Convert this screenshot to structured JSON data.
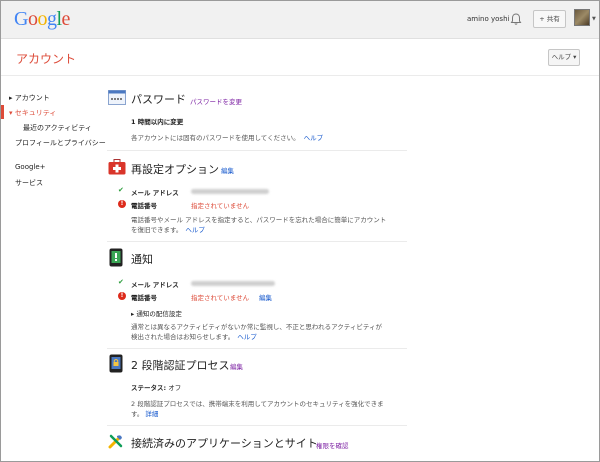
{
  "topbar": {
    "logo": [
      "G",
      "o",
      "o",
      "g",
      "l",
      "e"
    ],
    "logo_colors": [
      "#4285f4",
      "#dd4b39",
      "#f4b400",
      "#4285f4",
      "#0f9d58",
      "#dd4b39"
    ],
    "user_name": "amino yoshi",
    "share_label": "+ 共有"
  },
  "header": {
    "title": "アカウント",
    "help_label": "ヘルプ ▾"
  },
  "sidebar": {
    "items": [
      {
        "label": "▸ アカウント"
      },
      {
        "label": "▾ セキュリティ"
      },
      {
        "label": "最近のアクティビティ"
      },
      {
        "label": "プロフィールとプライバシー"
      },
      {
        "label": "Google+"
      },
      {
        "label": "サービス"
      }
    ]
  },
  "password": {
    "title": "パスワード",
    "link": "パスワードを変更",
    "changed": "1 時間以内に変更",
    "desc": "各アカウントには固有のパスワードを使用してください。",
    "help": "ヘルプ"
  },
  "recovery": {
    "title": "再設定オプション",
    "edit": "編集",
    "email_label": "メール アドレス",
    "phone_label": "電話番号",
    "phone_value": "指定されていません",
    "desc1": "電話番号やメール アドレスを指定すると、パスワードを忘れた場合に簡単にアカウント",
    "desc2": "を復旧できます。",
    "help": "ヘルプ"
  },
  "notify": {
    "title": "通知",
    "email_label": "メール アドレス",
    "phone_label": "電話番号",
    "phone_value": "指定されていません",
    "edit": "編集",
    "delivery": "▸ 通知の配信設定",
    "desc1": "通常とは異なるアクティビティがないか常に監視し、不正と思われるアクティビティが",
    "desc2": "検出された場合はお知らせします。",
    "help": "ヘルプ"
  },
  "twostep": {
    "title": "2 段階認証プロセス",
    "edit": "編集",
    "status_label": "ステータス:",
    "status_value": "オフ",
    "desc1": "2 段階認証プロセスでは、携帯端末を利用してアカウントのセキュリティを強化できま",
    "desc2": "す。",
    "details": "詳細"
  },
  "apps": {
    "title": "接続済みのアプリケーションとサイト",
    "link": "権限を確認"
  }
}
